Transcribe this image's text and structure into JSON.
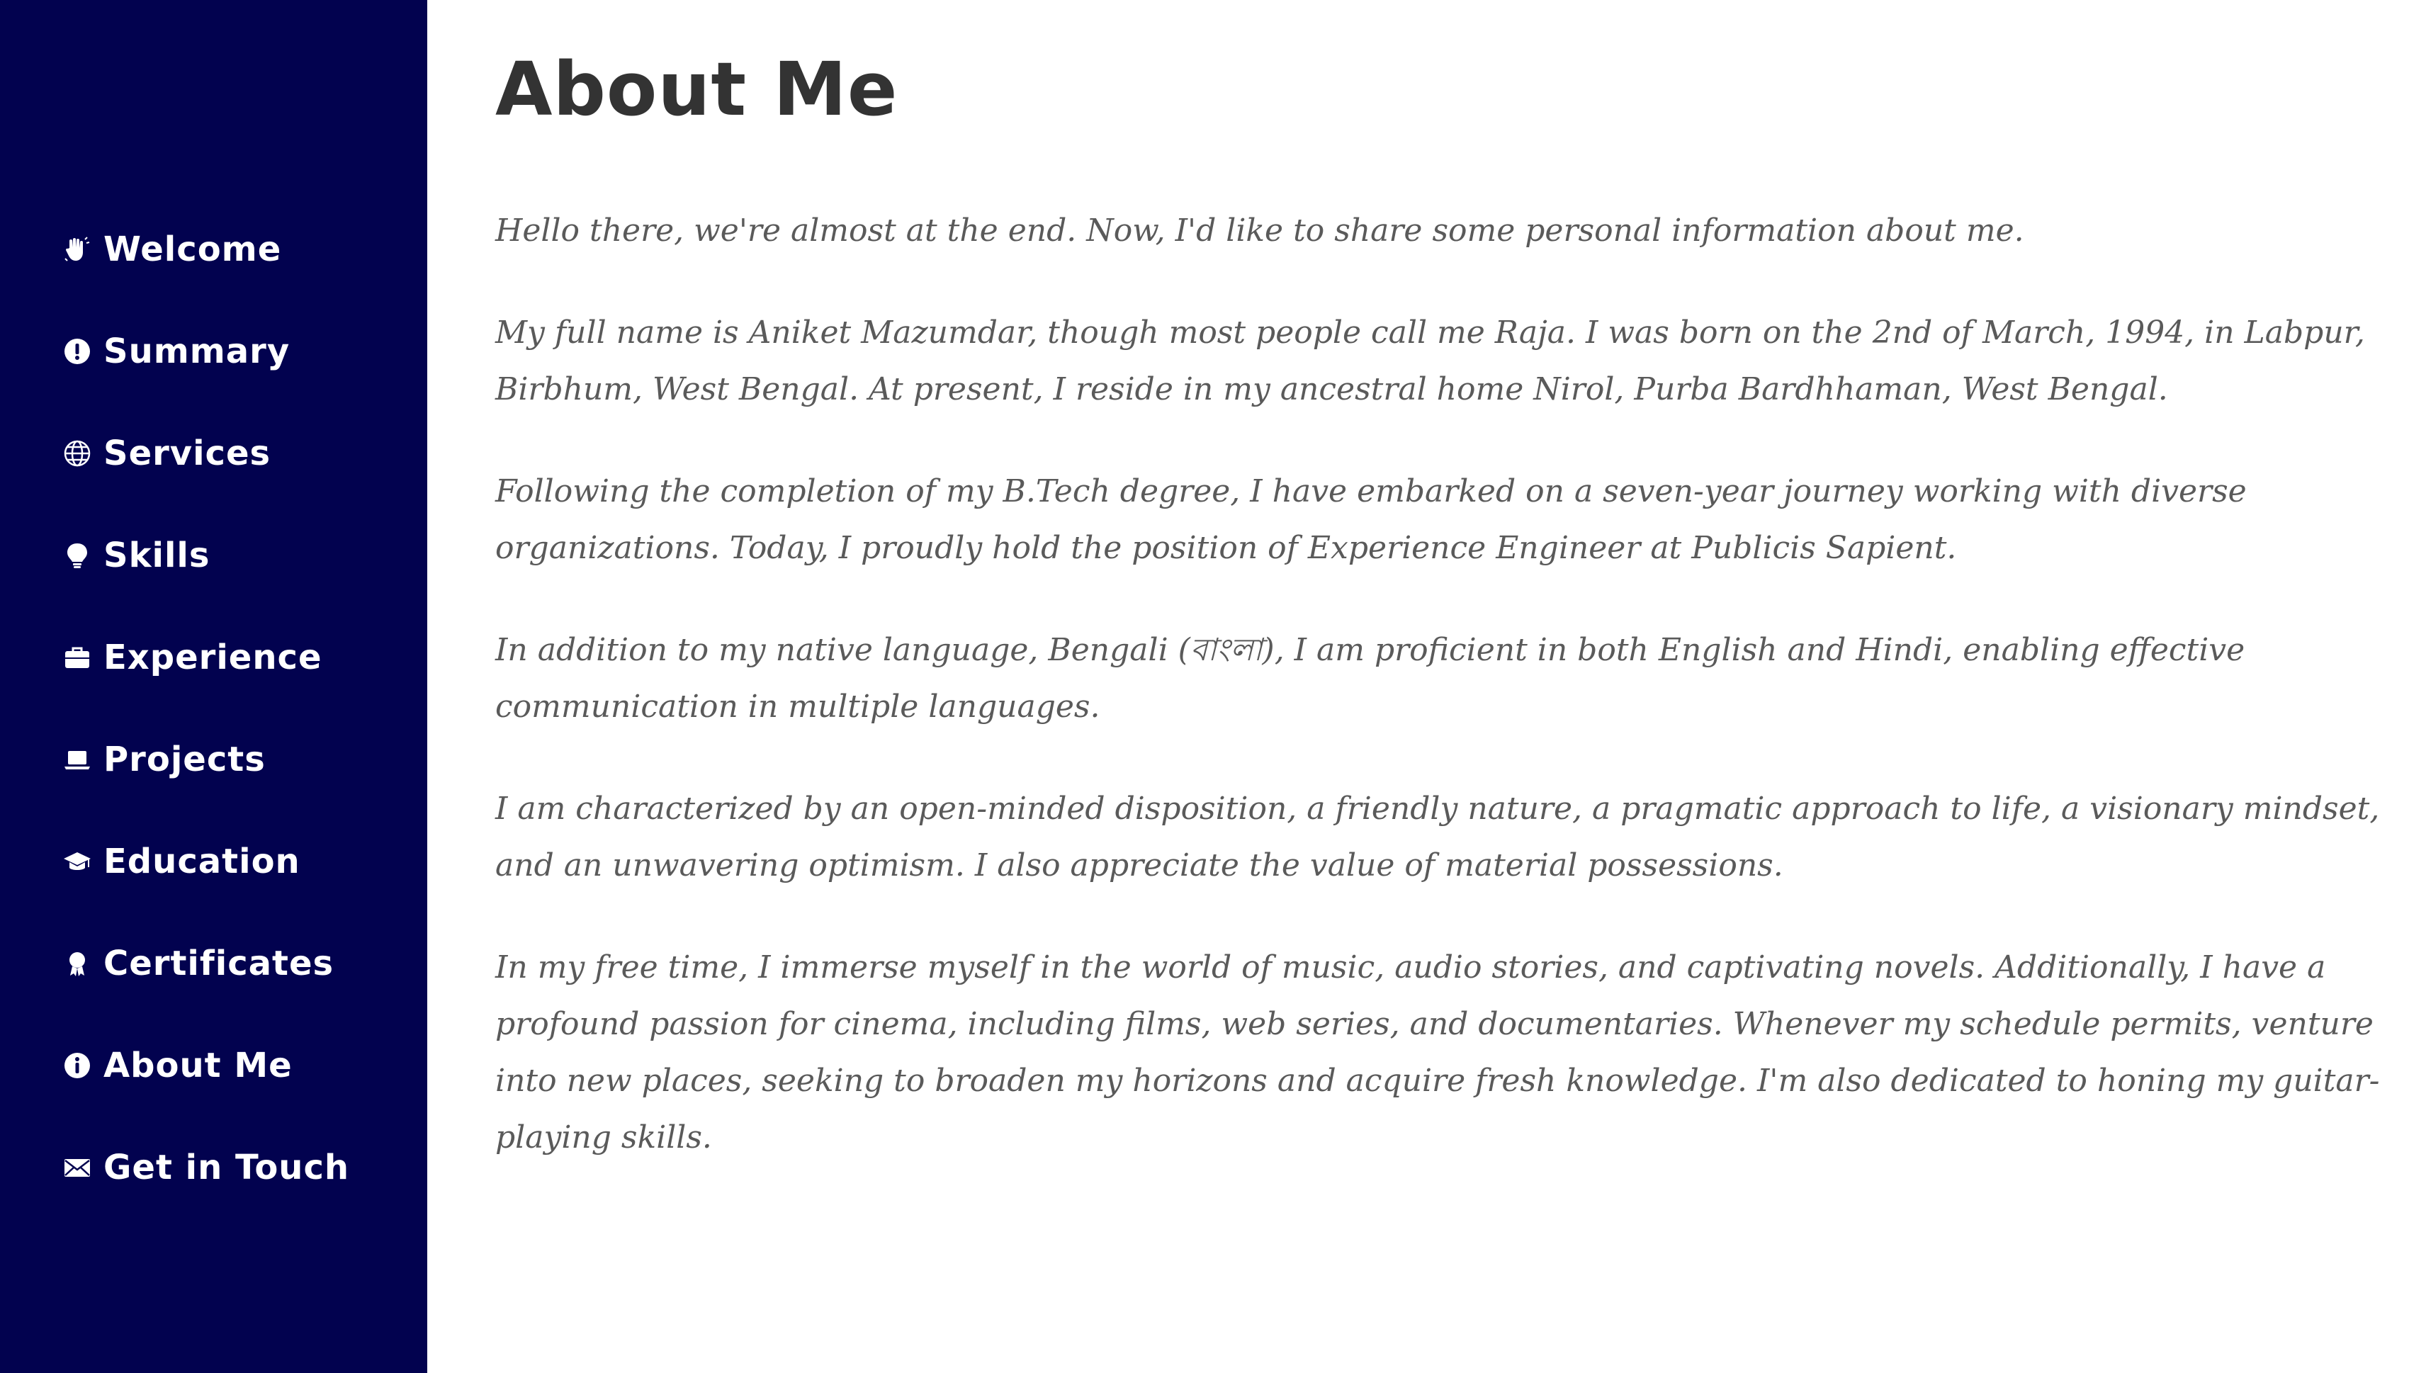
{
  "sidebar": {
    "background": "#02024f",
    "items": [
      {
        "label": "Welcome",
        "icon": "hand-wave-icon"
      },
      {
        "label": "Summary",
        "icon": "exclamation-circle-icon"
      },
      {
        "label": "Services",
        "icon": "globe-icon"
      },
      {
        "label": "Skills",
        "icon": "lightbulb-icon"
      },
      {
        "label": "Experience",
        "icon": "briefcase-icon"
      },
      {
        "label": "Projects",
        "icon": "laptop-icon"
      },
      {
        "label": "Education",
        "icon": "graduation-cap-icon"
      },
      {
        "label": "Certificates",
        "icon": "award-icon"
      },
      {
        "label": "About Me",
        "icon": "info-circle-icon"
      },
      {
        "label": "Get in Touch",
        "icon": "envelope-icon"
      }
    ]
  },
  "main": {
    "title": "About Me",
    "paragraphs": [
      "Hello there, we're almost at the end. Now, I'd like to share some personal information about me.",
      "My full name is Aniket Mazumdar, though most people call me Raja. I was born on the 2nd of March, 1994, in Labpur, Birbhum, West Bengal. At present, I reside in my ancestral home Nirol, Purba Bardhhaman, West Bengal.",
      "Following the completion of my B.Tech degree, I have embarked on a seven-year journey working with diverse organizations. Today, I proudly hold the position of Experience Engineer at Publicis Sapient.",
      "In addition to my native language, Bengali (বাংলা), I am proficient in both English and Hindi, enabling effective communication in multiple languages.",
      "I am characterized by an open-minded disposition, a friendly nature, a pragmatic approach to life, a visionary mindset, and an unwavering optimism. I also appreciate the value of material possessions.",
      "In my free time, I immerse myself in the world of music, audio stories, and captivating novels. Additionally, I have a profound passion for cinema, including films, web series, and documentaries. Whenever my schedule permits, venture into new places, seeking to broaden my horizons and acquire fresh knowledge. I'm also dedicated to honing my guitar-playing skills."
    ]
  },
  "colors": {
    "sidebar_bg": "#02024f",
    "nav_text": "#ffffff",
    "title_text": "#333333",
    "body_text": "#5a5a5a",
    "page_bg": "#ffffff"
  }
}
